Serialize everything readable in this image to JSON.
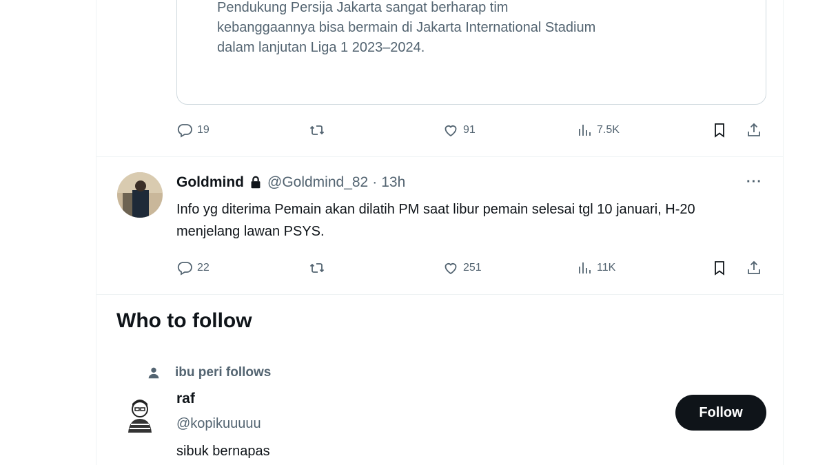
{
  "quoted_card": {
    "text": "Pendukung Persija Jakarta sangat berharap tim\nkebanggaannya bisa bermain di Jakarta International Stadium\ndalam lanjutan Liga 1 2023–2024."
  },
  "tweet1_actions": {
    "replies": "19",
    "retweets": "",
    "likes": "91",
    "views": "7.5K"
  },
  "tweet2": {
    "name": "Goldmind",
    "handle": "@Goldmind_82",
    "separator": "·",
    "time": "13h",
    "more": "···",
    "text": "Info yg diterima Pemain akan dilatih PM saat libur pemain selesai tgl 10 januari, H-20 menjelang lawan PSYS.",
    "actions": {
      "replies": "22",
      "retweets": "",
      "likes": "251",
      "views": "11K"
    }
  },
  "who_to_follow": {
    "title": "Who to follow",
    "social_context": "ibu peri follows",
    "user": {
      "name": "raf",
      "handle": "@kopikuuuuu",
      "bio": "sibuk bernapas"
    },
    "follow_label": "Follow"
  },
  "icons": {
    "reply": "reply-icon",
    "retweet": "retweet-icon",
    "like": "heart-icon",
    "views": "analytics-icon",
    "bookmark": "bookmark-icon",
    "share": "share-icon",
    "lock": "lock-icon",
    "person": "person-icon"
  },
  "colors": {
    "text_primary": "#0f1419",
    "text_secondary": "#536471",
    "border": "#eff3f4",
    "button_bg": "#0f1419"
  }
}
